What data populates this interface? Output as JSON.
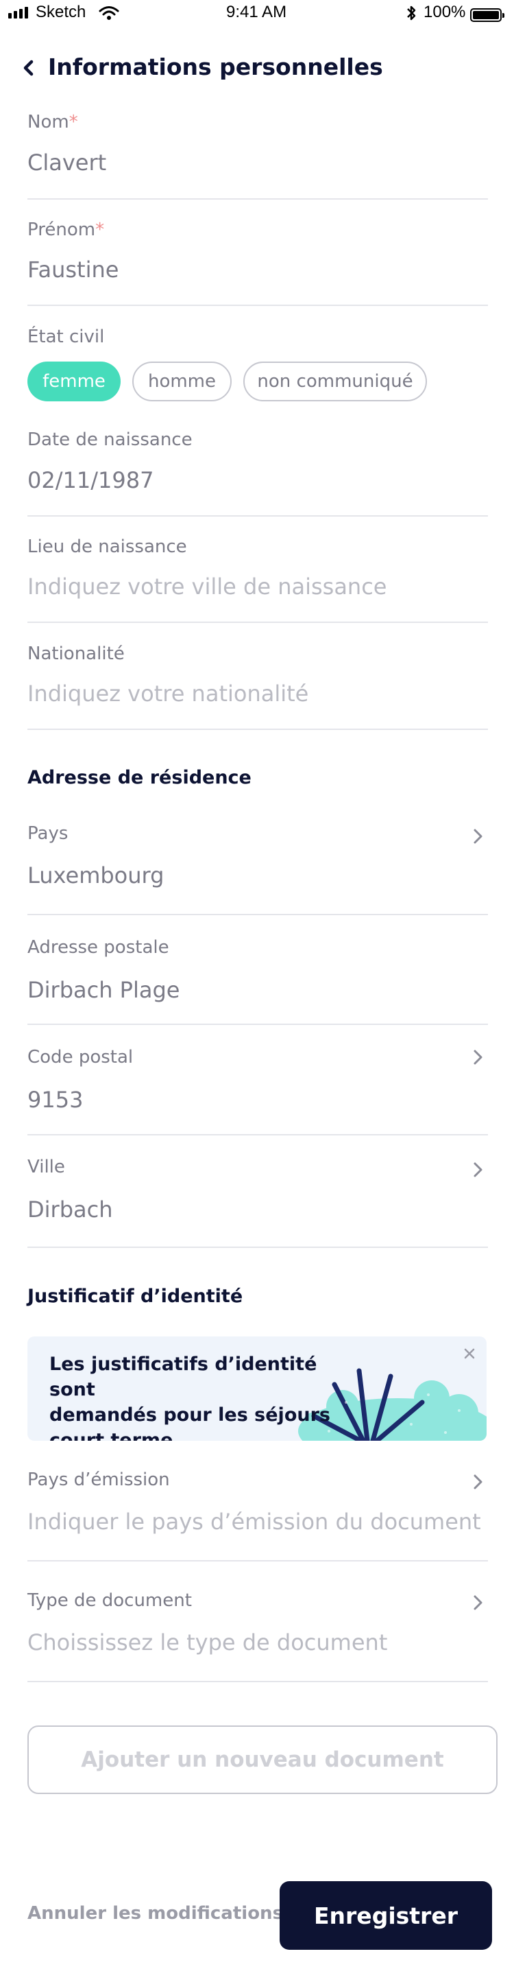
{
  "status_bar": {
    "carrier": "Sketch",
    "time": "9:41 AM",
    "battery": "100%"
  },
  "header": {
    "title": "Informations personnelles"
  },
  "fields": {
    "nom": {
      "label": "Nom",
      "required": "*",
      "value": "Clavert"
    },
    "prenom": {
      "label": "Prénom",
      "required": "*",
      "value": "Faustine"
    },
    "etat_civil": {
      "label": "État civil",
      "options": [
        "femme",
        "homme",
        "non communiqué"
      ],
      "selected": "femme"
    },
    "date_naissance": {
      "label": "Date de naissance",
      "value": "02/11/1987"
    },
    "lieu_naissance": {
      "label": "Lieu de naissance",
      "placeholder": "Indiquez votre ville de naissance"
    },
    "nationalite": {
      "label": "Nationalité",
      "placeholder": "Indiquez votre nationalité"
    }
  },
  "address": {
    "section_title": "Adresse de résidence",
    "pays": {
      "label": "Pays",
      "value": "Luxembourg"
    },
    "adresse_postale": {
      "label": "Adresse postale",
      "value": "Dirbach Plage"
    },
    "code_postal": {
      "label": "Code postal",
      "value": "9153"
    },
    "ville": {
      "label": "Ville",
      "value": "Dirbach"
    }
  },
  "identity": {
    "section_title": "Justificatif d’identité",
    "banner": {
      "line1": "Les justificatifs d’identité sont",
      "line2": "demandés pour les séjours",
      "line3": "court terme"
    },
    "pays_emission": {
      "label": "Pays d’émission",
      "placeholder": "Indiquer le pays d’émission du document"
    },
    "type_document": {
      "label": "Type de document",
      "placeholder": "Choississez le type de document"
    },
    "add_button": "Ajouter un nouveau document"
  },
  "footer": {
    "cancel": "Annuler les modifications",
    "save": "Enregistrer"
  },
  "colors": {
    "accent": "#46dcbb",
    "navy": "#0d1333",
    "required": "#ef8f8f",
    "banner_bg": "#eff4fb"
  }
}
